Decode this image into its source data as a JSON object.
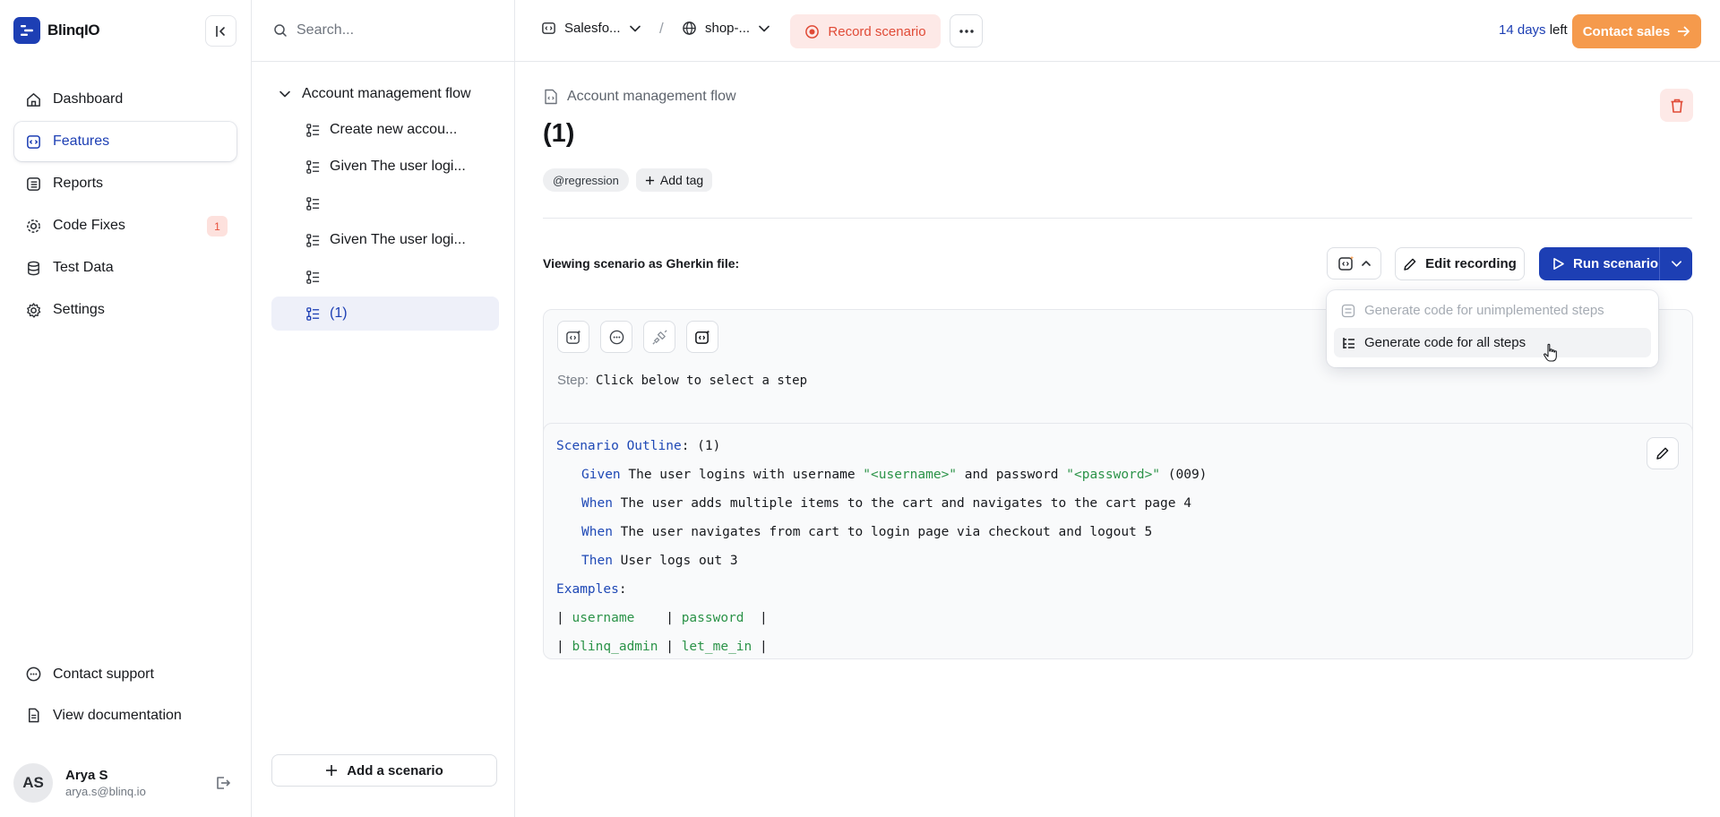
{
  "app": {
    "name": "BlinqIO"
  },
  "sidebar": {
    "nav": [
      {
        "label": "Dashboard",
        "icon": "home-icon"
      },
      {
        "label": "Features",
        "icon": "features-icon",
        "active": true
      },
      {
        "label": "Reports",
        "icon": "reports-icon"
      },
      {
        "label": "Code Fixes",
        "icon": "code-fixes-icon",
        "badge": "1"
      },
      {
        "label": "Test Data",
        "icon": "database-icon"
      },
      {
        "label": "Settings",
        "icon": "settings-icon"
      }
    ],
    "bottom": [
      {
        "label": "Contact support",
        "icon": "chat-icon"
      },
      {
        "label": "View documentation",
        "icon": "document-icon"
      }
    ],
    "user": {
      "initials": "AS",
      "name": "Arya S",
      "email": "arya.s@blinq.io"
    }
  },
  "tree": {
    "search_placeholder": "Search...",
    "parent": "Account management flow",
    "items": [
      {
        "label": "Create new accou..."
      },
      {
        "label": "Given The user logi..."
      },
      {
        "label": ""
      },
      {
        "label": "Given The user logi..."
      },
      {
        "label": ""
      },
      {
        "label": "(1)",
        "active": true
      }
    ],
    "add_scenario": "Add a scenario"
  },
  "topbar": {
    "project": "Salesfo...",
    "environment": "shop-...",
    "separator": "/",
    "record": "Record scenario",
    "trial_days": "14 days",
    "trial_suffix": " left",
    "contact_sales": "Contact sales"
  },
  "main": {
    "feature_name": "Account management flow",
    "title": "(1)",
    "tags": [
      "@regression"
    ],
    "add_tag": "Add tag",
    "viewing_label": "Viewing scenario as Gherkin file:",
    "edit_recording": "Edit recording",
    "run_scenario": "Run scenario",
    "step_label": "Step:",
    "step_value": "Click below to select a step"
  },
  "code": {
    "outline_kw": "Scenario Outline",
    "outline_rest": ": (1)",
    "steps": [
      {
        "kw": "Given",
        "t1": " The user logins with username ",
        "s1": "\"<username>\"",
        "t2": " and password ",
        "s2": "\"<password>\"",
        "t3": " (009)"
      },
      {
        "kw": "When",
        "t1": " The user adds multiple items to the cart and navigates to the cart page 4"
      },
      {
        "kw": "When",
        "t1": " The user navigates from cart to login page via checkout and logout 5"
      },
      {
        "kw": "Then",
        "t1": " User logs out 3"
      }
    ],
    "examples_kw": "Examples",
    "examples_rest": ":",
    "header": {
      "c1": "username",
      "c2": "password"
    },
    "row": {
      "c1": "blinq_admin",
      "c2": "let_me_in"
    }
  },
  "dropdown": {
    "items": [
      {
        "label": "Generate code for unimplemented steps",
        "disabled": true
      },
      {
        "label": "Generate code for all steps",
        "disabled": false
      }
    ]
  },
  "colors": {
    "brand": "#1d3fb4",
    "accent_orange": "#f59a4c",
    "danger": "#e04a36",
    "string_green": "#2b9348"
  }
}
